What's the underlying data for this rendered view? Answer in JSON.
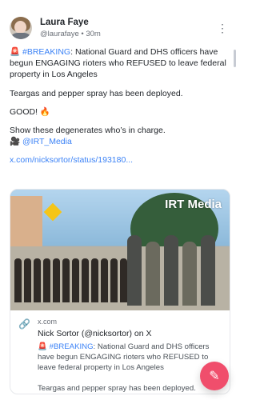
{
  "post": {
    "author": "Laura Faye",
    "handle": "@laurafaye",
    "separator": " • ",
    "time": "30m",
    "lines": [
      {
        "prefix": "🚨 ",
        "hashtag": "#BREAKING",
        "text": ": National Guard and DHS officers have begun ENGAGING rioters who REFUSED to leave federal property in Los Angeles"
      },
      {
        "text": "Teargas and pepper spray has been deployed."
      },
      {
        "text": "GOOD! 🔥"
      },
      {
        "text": "Show these degenerates who’s in charge."
      },
      {
        "prefix": "🎥 ",
        "mention": "@IRT_Media"
      }
    ],
    "link": "x.com/nicksortor/status/193180..."
  },
  "card": {
    "badge": "IRT Media",
    "domain": "x.com",
    "title": "Nick Sortor (@nicksortor) on X",
    "description_prefix": "🚨 ",
    "description_hashtag": "#BREAKING",
    "description": ": National Guard and DHS officers have begun ENGAGING rioters who REFUSED to leave federal property in Los Angeles",
    "description2": "Teargas and pepper spray has been deployed."
  },
  "icons": {
    "more": "more-vertical-icon",
    "link": "link-icon",
    "compose": "compose-icon"
  }
}
